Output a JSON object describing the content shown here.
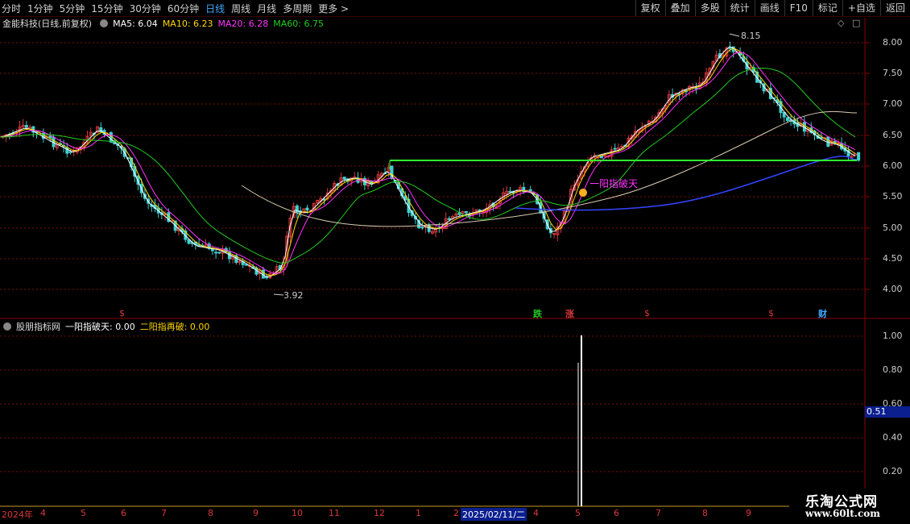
{
  "toolbar": {
    "periods": [
      "分时",
      "1分钟",
      "5分钟",
      "15分钟",
      "30分钟",
      "60分钟",
      "日线",
      "周线",
      "月线",
      "多周期",
      "更多 >"
    ],
    "active_period": "日线",
    "actions": [
      "复权",
      "叠加",
      "多股",
      "统计",
      "画线",
      "F10",
      "标记",
      "+自选",
      "返回"
    ]
  },
  "main_info": {
    "title": "金能科技(日线,前复权)",
    "ma5": "MA5: 6.04",
    "ma10": "MA10: 6.23",
    "ma20": "MA20: 6.28",
    "ma60": "MA60: 6.75"
  },
  "indicator_info": {
    "name": "股朋指标网",
    "line1": "一阳指破天: 0.00",
    "line2": "二阳指再破: 0.00"
  },
  "price_axis": [
    "8.00",
    "7.50",
    "7.00",
    "6.50",
    "6.00",
    "5.50",
    "5.00",
    "4.50",
    "4.00"
  ],
  "indicator_axis": [
    "1.00",
    "0.80",
    "0.60",
    "0.40",
    "0.20"
  ],
  "indicator_current": "0.51",
  "high_label": "8.15",
  "low_label": "3.92",
  "signal_label": "一阳指破天",
  "event_markers": [
    {
      "text": "$",
      "color": "#d8383a"
    },
    {
      "text": "跌",
      "color": "#22cc22"
    },
    {
      "text": "涨",
      "color": "#d8383a"
    },
    {
      "text": "$",
      "color": "#d8383a"
    },
    {
      "text": "$",
      "color": "#d8383a"
    },
    {
      "text": "财",
      "color": "#3fa9ff"
    }
  ],
  "date_axis": [
    "2024年",
    "4",
    "5",
    "6",
    "7",
    "8",
    "9",
    "10",
    "11",
    "12",
    "1",
    "2",
    "4",
    "5",
    "6",
    "7",
    "8",
    "9"
  ],
  "date_selected": "2025/02/11/二",
  "watermark": {
    "line1": "乐淘公式网",
    "line2": "www.60lt.com"
  },
  "colors": {
    "ma5": "#ffffff",
    "ma10": "#ffd700",
    "ma20": "#ff33ff",
    "ma60": "#22cc22",
    "up": "#d8383a",
    "down": "#3fcfcf"
  }
}
